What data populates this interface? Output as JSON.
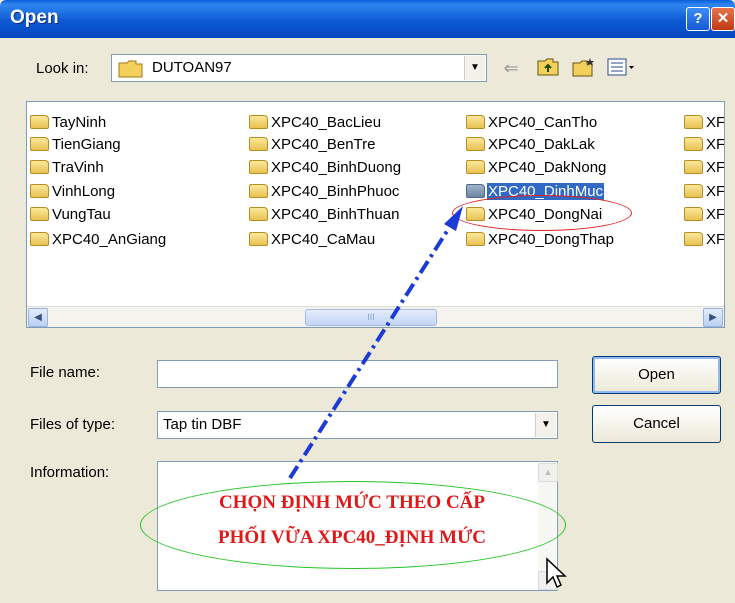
{
  "window": {
    "title": "Open",
    "help_label": "?",
    "close_label": "✕"
  },
  "lookin": {
    "label": "Look in:",
    "value": "DUTOAN97",
    "icons": [
      "back-arrow-icon",
      "up-folder-icon",
      "new-folder-icon",
      "view-menu-icon"
    ]
  },
  "files": {
    "columns": [
      [
        "TayNinh",
        "TienGiang",
        "TraVinh",
        "VinhLong",
        "VungTau",
        "XPC40_AnGiang"
      ],
      [
        "XPC40_BacLieu",
        "XPC40_BenTre",
        "XPC40_BinhDuong",
        "XPC40_BinhPhuoc",
        "XPC40_BinhThuan",
        "XPC40_CaMau"
      ],
      [
        "XPC40_CanTho",
        "XPC40_DakLak",
        "XPC40_DakNong",
        "XPC40_DinhMuc",
        "XPC40_DongNai",
        "XPC40_DongThap"
      ],
      [
        "XF",
        "XF",
        "XF",
        "XF",
        "XF",
        "XF"
      ]
    ],
    "selected": "XPC40_DinhMuc",
    "scroll_thumb_glyph": "III"
  },
  "filename": {
    "label": "File name:",
    "value": ""
  },
  "filetype": {
    "label": "Files of type:",
    "value": "Tap tin DBF"
  },
  "information": {
    "label": "Information:"
  },
  "buttons": {
    "open": "Open",
    "cancel": "Cancel"
  },
  "annotation": {
    "line1": "CHỌN ĐỊNH MỨC THEO CẤP",
    "line2": "PHỐI VỮA XPC40_ĐỊNH MỨC",
    "color": "#e01818"
  },
  "colors": {
    "title_bar": "#0a5fd8",
    "selection": "#316ac5",
    "dialog_bg": "#ece9d8"
  }
}
